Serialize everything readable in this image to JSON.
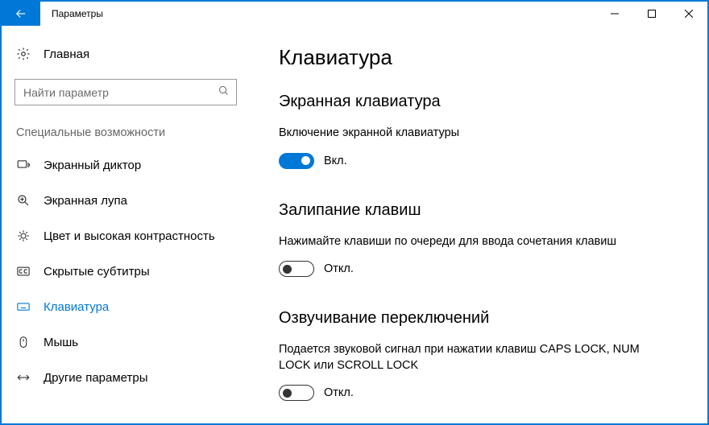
{
  "titlebar": {
    "title": "Параметры"
  },
  "sidebar": {
    "home_label": "Главная",
    "search_placeholder": "Найти параметр",
    "section_label": "Специальные возможности",
    "items": [
      {
        "label": "Экранный диктор"
      },
      {
        "label": "Экранная лупа"
      },
      {
        "label": "Цвет и высокая контрастность"
      },
      {
        "label": "Скрытые субтитры"
      },
      {
        "label": "Клавиатура"
      },
      {
        "label": "Мышь"
      },
      {
        "label": "Другие параметры"
      }
    ]
  },
  "content": {
    "page_title": "Клавиатура",
    "sections": [
      {
        "heading": "Экранная клавиатура",
        "desc": "Включение экранной клавиатуры",
        "toggle_state": "Вкл.",
        "on": true
      },
      {
        "heading": "Залипание клавиш",
        "desc": "Нажимайте клавиши по очереди для ввода сочетания клавиш",
        "toggle_state": "Откл.",
        "on": false
      },
      {
        "heading": "Озвучивание переключений",
        "desc": "Подается звуковой сигнал при нажатии клавиш CAPS LOCK, NUM LOCK или SCROLL LOCK",
        "toggle_state": "Откл.",
        "on": false
      }
    ]
  }
}
